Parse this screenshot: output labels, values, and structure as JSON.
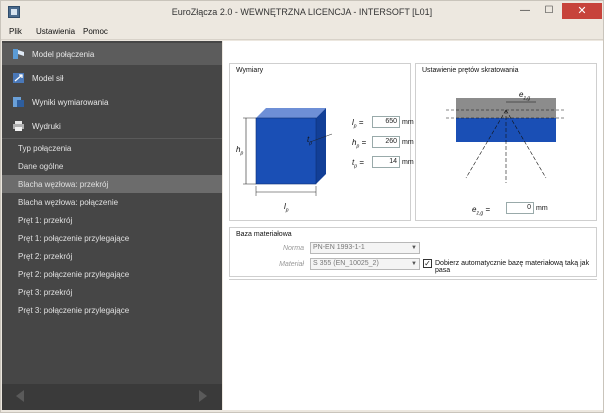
{
  "window": {
    "title": "EuroZłącza 2.0 - WEWNĘTRZNA LICENCJA - INTERSOFT [L01]",
    "close_glyph": "✕",
    "min_glyph": "—",
    "max_glyph": "☐"
  },
  "menu": [
    "Plik",
    "Ustawienia",
    "Pomoc"
  ],
  "sidebar": {
    "nav": [
      {
        "label": "Model połączenia",
        "icon": "joint-model-icon"
      },
      {
        "label": "Model sił",
        "icon": "forces-model-icon"
      },
      {
        "label": "Wyniki wymiarowania",
        "icon": "results-icon"
      },
      {
        "label": "Wydruki",
        "icon": "printer-icon"
      }
    ],
    "subitems": [
      "Typ połączenia",
      "Dane ogólne",
      "Blacha węzłowa: przekrój",
      "Blacha węzłowa: połączenie",
      "Pręt 1: przekrój",
      "Pręt 1: połączenie przylegające",
      "Pręt 2: przekrój",
      "Pręt 2: połączenie przylegające",
      "Pręt 3: przekrój",
      "Pręt 3: połączenie przylegające"
    ]
  },
  "dimensions": {
    "title": "Wymiary",
    "lp": {
      "label": "l",
      "sub": "p",
      "value": "650",
      "unit": "mm"
    },
    "hp": {
      "label": "h",
      "sub": "p",
      "value": "260",
      "unit": "mm"
    },
    "tp": {
      "label": "t",
      "sub": "p",
      "value": "14",
      "unit": "mm"
    },
    "diagram_tp": {
      "label": "t",
      "sub": "p"
    },
    "diagram_hp": {
      "label": "h",
      "sub": "p"
    },
    "diagram_lp": {
      "label": "l",
      "sub": "p"
    }
  },
  "bars_setting": {
    "title": "Ustawienie prętów skratowania",
    "ezg_label": "e",
    "ezg_sub": "z,g",
    "ezg_eq": "=",
    "ezg_value": "0",
    "ezg_unit": "mm",
    "diagram_label": "e",
    "diagram_sub": "z,g"
  },
  "material": {
    "title": "Baza materiałowa",
    "norm_label": "Norma",
    "norm_value": "PN-EN 1993-1-1",
    "material_label": "Materiał",
    "material_value": "S 355 (EN_10025_2)",
    "auto_checked": true,
    "auto_label": "Dobierz automatycznie bazę materiałową taką jak pasa"
  },
  "colors": {
    "plate_blue": "#1a4fb5",
    "sidebar_bg": "#464646",
    "accent_gray": "#8c8c8c"
  }
}
